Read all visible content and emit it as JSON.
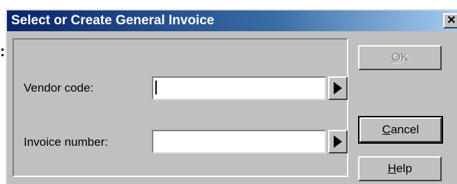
{
  "page_fragment": {
    "colon": ":"
  },
  "dialog": {
    "title": "Select or Create General Invoice",
    "close_glyph": "✕"
  },
  "form": {
    "vendor_code": {
      "label": "Vendor code:",
      "value": ""
    },
    "invoice_number": {
      "label": "Invoice number:",
      "value": ""
    }
  },
  "buttons": {
    "ok": {
      "mnemonic": "O",
      "rest": "K",
      "enabled": false
    },
    "cancel": {
      "mnemonic": "C",
      "rest": "ancel"
    },
    "help": {
      "mnemonic": "H",
      "rest": "elp"
    }
  },
  "icons": {
    "lookup": "triangle-right-icon",
    "close": "close-icon"
  },
  "colors": {
    "titlebar_start": "#0a246a",
    "titlebar_end": "#a6caf0",
    "face": "#c0c0c0"
  }
}
